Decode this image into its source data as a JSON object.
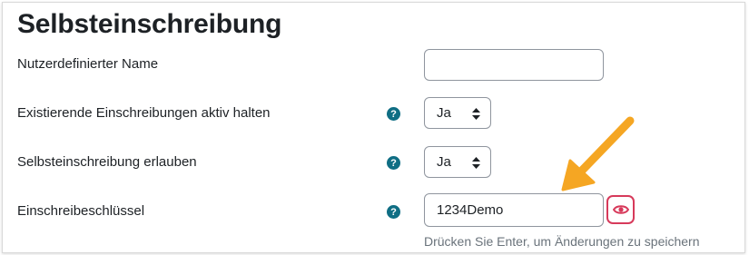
{
  "section": {
    "title": "Selbsteinschreibung"
  },
  "fields": {
    "custom_name": {
      "label": "Nutzerdefinierter Name",
      "value": ""
    },
    "keep_active": {
      "label": "Existierende Einschreibungen aktiv halten",
      "value": "Ja"
    },
    "allow_self": {
      "label": "Selbsteinschreibung erlauben",
      "value": "Ja"
    },
    "enrol_key": {
      "label": "Einschreibeschlüssel",
      "value": "1234Demo",
      "hint": "Drücken Sie Enter, um Änderungen zu speichern"
    }
  },
  "help_glyph": "?",
  "icons": {
    "help": "question-circle-icon",
    "reveal": "eye-icon",
    "select": "up-down-arrows-icon",
    "annotation": "pointer-arrow"
  },
  "colors": {
    "help": "#0f6e84",
    "reveal_border": "#d73a5b",
    "annotation_arrow": "#f5a623",
    "hint_text": "#6a737b"
  }
}
